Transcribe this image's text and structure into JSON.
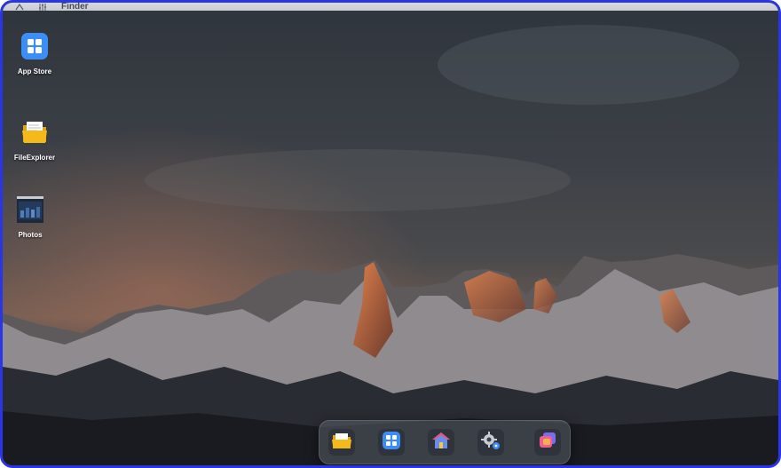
{
  "menubar": {
    "logo_icon": "triangle-logo-icon",
    "system_icon": "sliders-icon",
    "app_name": "Finder"
  },
  "desktop": {
    "icons": [
      {
        "label": "App Store",
        "icon": "app-store-icon"
      },
      {
        "label": "FileExplorer",
        "icon": "folder-icon"
      },
      {
        "label": "Photos",
        "icon": "photos-icon"
      }
    ]
  },
  "dock": {
    "items": [
      {
        "icon": "folder-icon"
      },
      {
        "icon": "app-store-icon"
      },
      {
        "icon": "home-icon"
      },
      {
        "icon": "settings-icon"
      },
      {
        "icon": "windows-icon"
      }
    ]
  },
  "colors": {
    "frame_border": "#2a36e6",
    "app_store_blue": "#3b8ef5",
    "folder_yellow": "#f6b91a"
  }
}
